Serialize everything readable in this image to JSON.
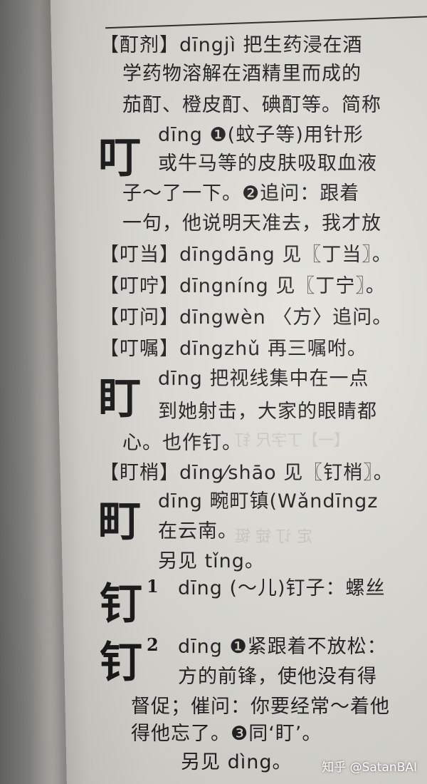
{
  "lines": [
    "【酊剂】dīngjì  把生药浸在酒",
    "学药物溶解在酒精里而成的",
    "茄酊、橙皮酊、碘酊等。简称",
    "dīng ❶(蚊子等)用针形",
    "或牛马等的皮肤吸取血液",
    "子～了一下。❷追问：跟着",
    "一句，他说明天准去，我才放",
    "【叮当】dīngdāng 见〖丁当〗。",
    "【叮咛】dīngníng 见〖丁宁〗。",
    "【叮问】dīngwèn 〈方〉追问。",
    "【叮嘱】dīngzhǔ 再三嘱咐。",
    "dīng 把视线集中在一点",
    "到她射击，大家的眼睛都",
    "心。也作钉。",
    "【盯梢】dīng⁄shāo 见〖钉梢〗。",
    "dīng 畹町镇(Wǎndīngz",
    "在云南。",
    "另见 tǐng。",
    "dīng (～儿)钉子：螺丝",
    "dīng ❶紧跟着不放松：",
    "方的前锋，使他没有得",
    "督促；催问：你要经常～着他",
    "得他忘了。❸同‘盯’。",
    "另见 dìng。"
  ],
  "heads": [
    "叮",
    "盯",
    "町",
    "钉",
    "钉"
  ],
  "sups": [
    "1",
    "2"
  ],
  "watermark": "知乎 @SatanBAI"
}
